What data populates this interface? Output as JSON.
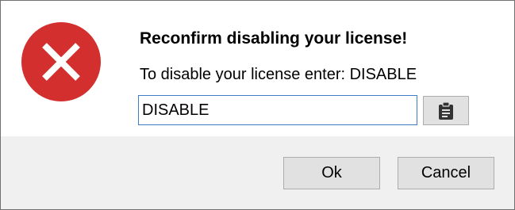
{
  "dialog": {
    "title": "Reconfirm disabling your license!",
    "instruction": "To disable your license enter: DISABLE",
    "input_value": "DISABLE",
    "icons": {
      "status": "error-x-icon",
      "paste": "clipboard-icon"
    },
    "colors": {
      "error_red": "#d32f2f",
      "input_border": "#3d7bc4",
      "footer_bg": "#f0f0f0"
    }
  },
  "buttons": {
    "ok_label": "Ok",
    "cancel_label": "Cancel"
  }
}
